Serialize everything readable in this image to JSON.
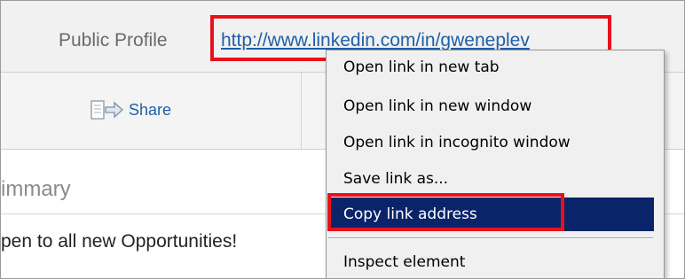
{
  "profile": {
    "public_label": "Public Profile",
    "url": "http://www.linkedin.com/in/gweneplev"
  },
  "toolbar": {
    "share_label": "Share"
  },
  "summary": {
    "title": "immary",
    "text": "pen to all new Opportunities!"
  },
  "context_menu": {
    "items": [
      {
        "label": "Open link in new tab"
      },
      {
        "label": "Open link in new window"
      },
      {
        "label": "Open link in incognito window"
      },
      {
        "label": "Save link as..."
      },
      {
        "label": "Copy link address",
        "selected": true
      },
      {
        "label": "Inspect element"
      }
    ]
  },
  "colors": {
    "highlight_box": "#e8111b",
    "selected_bg": "#0a246a",
    "link": "#1f5fa8"
  }
}
